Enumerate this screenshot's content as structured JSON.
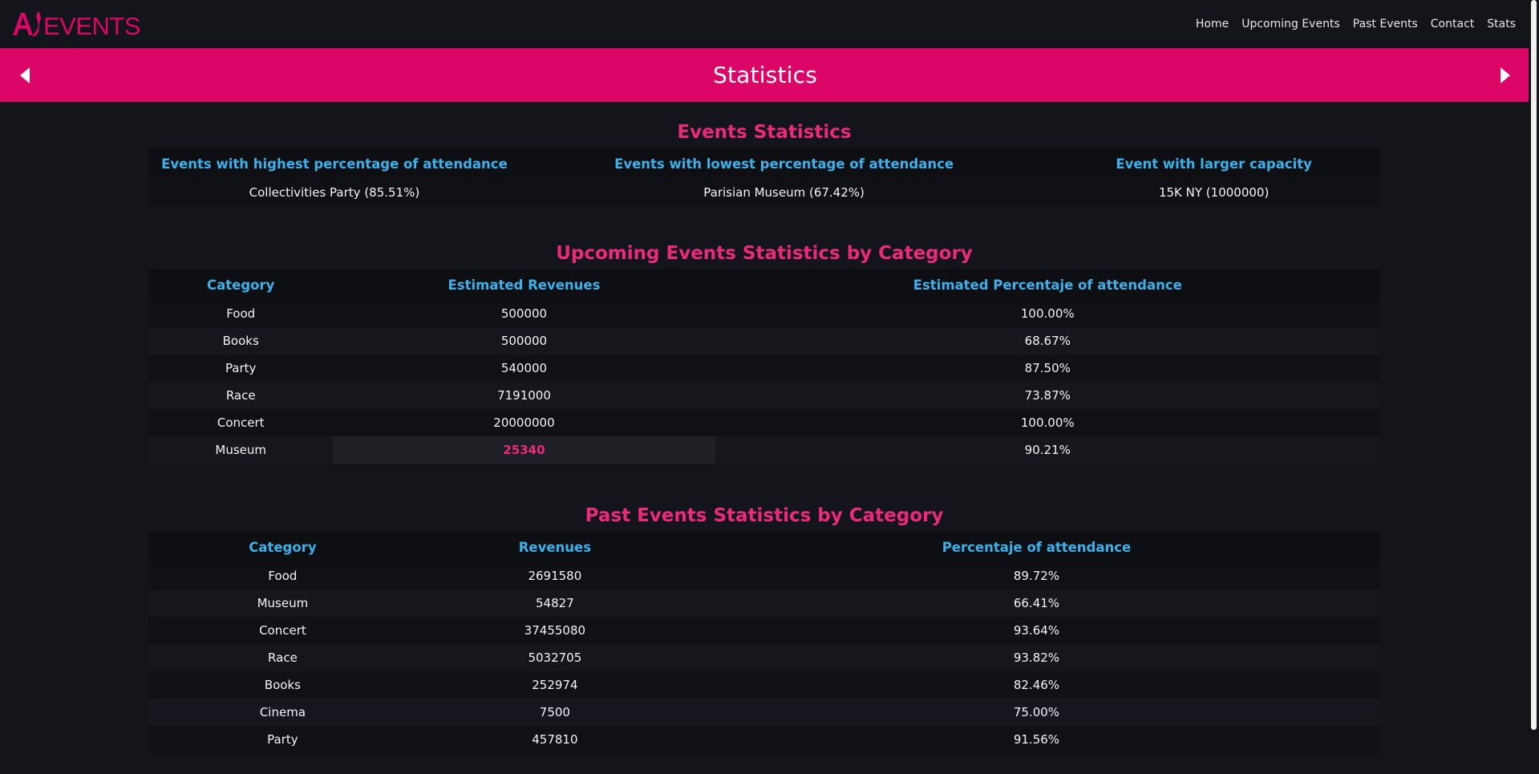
{
  "brand": {
    "logo_text": "ASEVENTS",
    "color": "#dc0568"
  },
  "nav": {
    "links": [
      "Home",
      "Upcoming Events",
      "Past Events",
      "Contact",
      "Stats"
    ]
  },
  "banner": {
    "title": "Statistics",
    "prev_icon": "caret-left-icon",
    "next_icon": "caret-right-icon"
  },
  "events_stats": {
    "title": "Events Statistics",
    "headers": [
      "Events with highest percentage of attendance",
      "Events with lowest percentage of attendance",
      "Event with larger capacity"
    ],
    "values": [
      "Collectivities Party (85.51%)",
      "Parisian Museum (67.42%)",
      "15K NY (1000000)"
    ]
  },
  "upcoming": {
    "title": "Upcoming Events Statistics by Category",
    "headers": [
      "Category",
      "Estimated Revenues",
      "Estimated Percentaje of attendance"
    ],
    "rows": [
      [
        "Food",
        "500000",
        "100.00%"
      ],
      [
        "Books",
        "500000",
        "68.67%"
      ],
      [
        "Party",
        "540000",
        "87.50%"
      ],
      [
        "Race",
        "7191000",
        "73.87%"
      ],
      [
        "Concert",
        "20000000",
        "100.00%"
      ],
      [
        "Museum",
        "25340",
        "90.21%"
      ]
    ]
  },
  "past": {
    "title": "Past Events Statistics by Category",
    "headers": [
      "Category",
      "Revenues",
      "Percentaje of attendance"
    ],
    "rows": [
      [
        "Food",
        "2691580",
        "89.72%"
      ],
      [
        "Museum",
        "54827",
        "66.41%"
      ],
      [
        "Concert",
        "37455080",
        "93.64%"
      ],
      [
        "Race",
        "5032705",
        "93.82%"
      ],
      [
        "Books",
        "252974",
        "82.46%"
      ],
      [
        "Cinema",
        "7500",
        "75.00%"
      ],
      [
        "Party",
        "457810",
        "91.56%"
      ]
    ]
  },
  "colors": {
    "background": "#13151a",
    "accent_pink": "#ec2a7d",
    "header_blue": "#3db1ec"
  }
}
